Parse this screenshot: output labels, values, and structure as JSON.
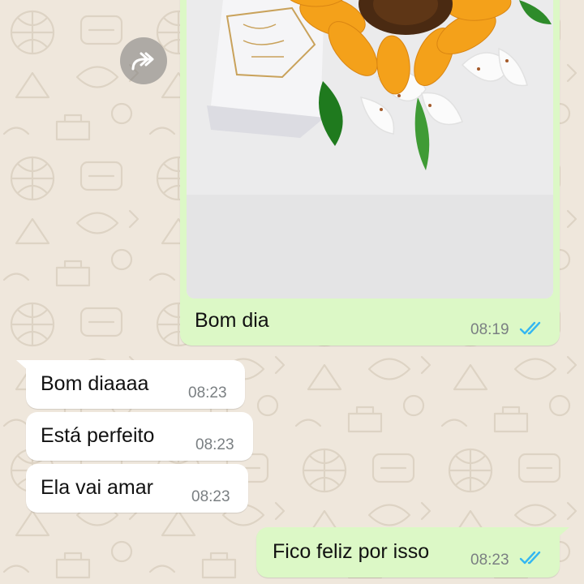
{
  "colors": {
    "wallpaper": "#efe7dc",
    "outgoing_bubble": "#dcf8c6",
    "incoming_bubble": "#ffffff",
    "read_ticks": "#34b7f1",
    "timestamp": "#7a7f82"
  },
  "forward_button": {
    "icon": "forward-icon"
  },
  "messages": [
    {
      "direction": "outgoing",
      "type": "image",
      "caption": "Bom dia",
      "time": "08:19",
      "status": "read"
    },
    {
      "direction": "incoming",
      "type": "text",
      "text": "Bom diaaaa",
      "time": "08:23"
    },
    {
      "direction": "incoming",
      "type": "text",
      "text": "Está perfeito",
      "time": "08:23"
    },
    {
      "direction": "incoming",
      "type": "text",
      "text": "Ela vai amar",
      "time": "08:23"
    },
    {
      "direction": "outgoing",
      "type": "text",
      "text": "Fico feliz por isso",
      "time": "08:23",
      "status": "read"
    }
  ]
}
